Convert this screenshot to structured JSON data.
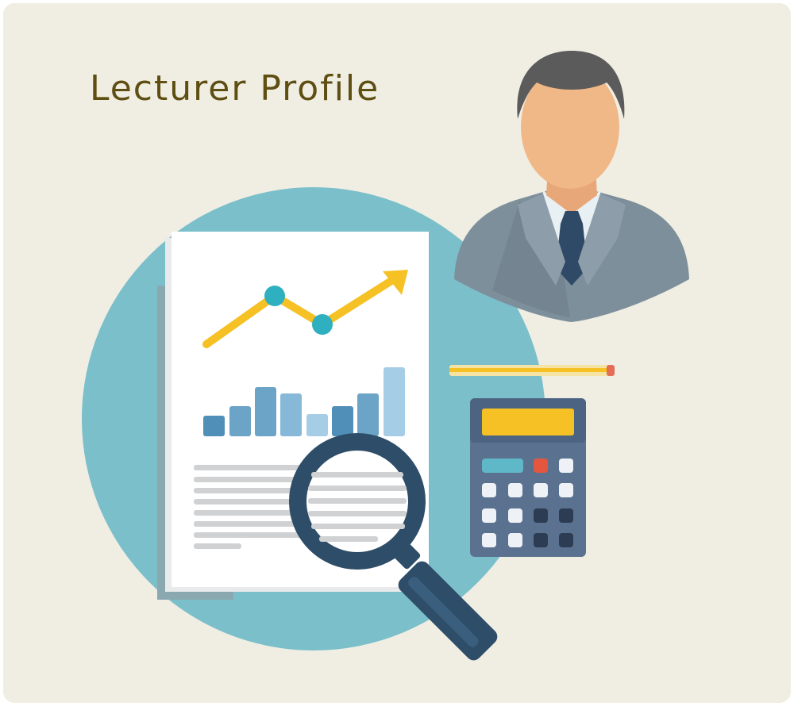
{
  "title": "Lecturer Profile",
  "colors": {
    "background": "#f0eee3",
    "title": "#5f4e12",
    "circle": "#7bbfcb",
    "line_chart": "#f5c124",
    "line_points": "#2fb0c0",
    "bars": [
      "#5090b8",
      "#6ca4c8",
      "#88b8d8",
      "#a6cde6"
    ],
    "suit": "#7e8f9c",
    "skin": "#f0b887",
    "hair": "#5b5b5b",
    "tie": "#2e4a66",
    "calculator_body": "#5a7190",
    "calculator_display": "#f5c124",
    "magnifier": "#2e4d68"
  },
  "icons": [
    "lecturer-avatar-icon",
    "report-document-icon",
    "magnifying-glass-icon",
    "calculator-icon",
    "pencil-icon"
  ]
}
